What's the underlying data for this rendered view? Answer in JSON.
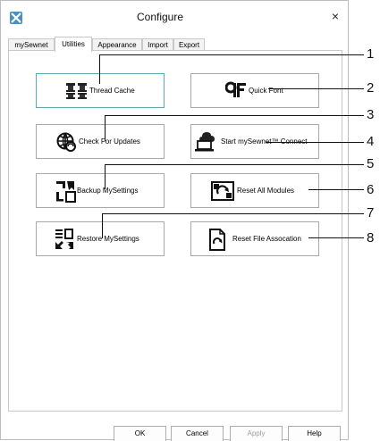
{
  "window": {
    "title": "Configure",
    "close_glyph": "×"
  },
  "tabs": [
    {
      "label": "mySewnet",
      "active": false
    },
    {
      "label": "Utilities",
      "active": true
    },
    {
      "label": "Appearance",
      "active": false
    },
    {
      "label": "Import",
      "active": false
    },
    {
      "label": "Export",
      "active": false
    }
  ],
  "utilities": {
    "thread_cache": "Thread Cache",
    "quick_font": "Quick Font",
    "check_updates": "Check For Updates",
    "start_connect": "Start mySewnet™ Connect",
    "backup_settings": "Backup MySettings",
    "reset_modules": "Reset All Modules",
    "restore_settings": "Restore MySettings",
    "reset_file_assoc": "Reset File Assocation"
  },
  "buttons": {
    "ok": "OK",
    "cancel": "Cancel",
    "apply": "Apply",
    "help": "Help"
  },
  "callouts": [
    "1",
    "2",
    "3",
    "4",
    "5",
    "6",
    "7",
    "8"
  ],
  "icons": {
    "app": "configure-app-icon",
    "thread_cache": "thread-spools-icon",
    "quick_font": "qf-font-icon",
    "check_updates": "globe-refresh-icon",
    "start_connect": "cloud-laptop-icon",
    "backup": "backup-arrows-icon",
    "reset_modules": "reset-modules-icon",
    "restore": "restore-arrows-icon",
    "reset_file": "file-refresh-icon"
  }
}
